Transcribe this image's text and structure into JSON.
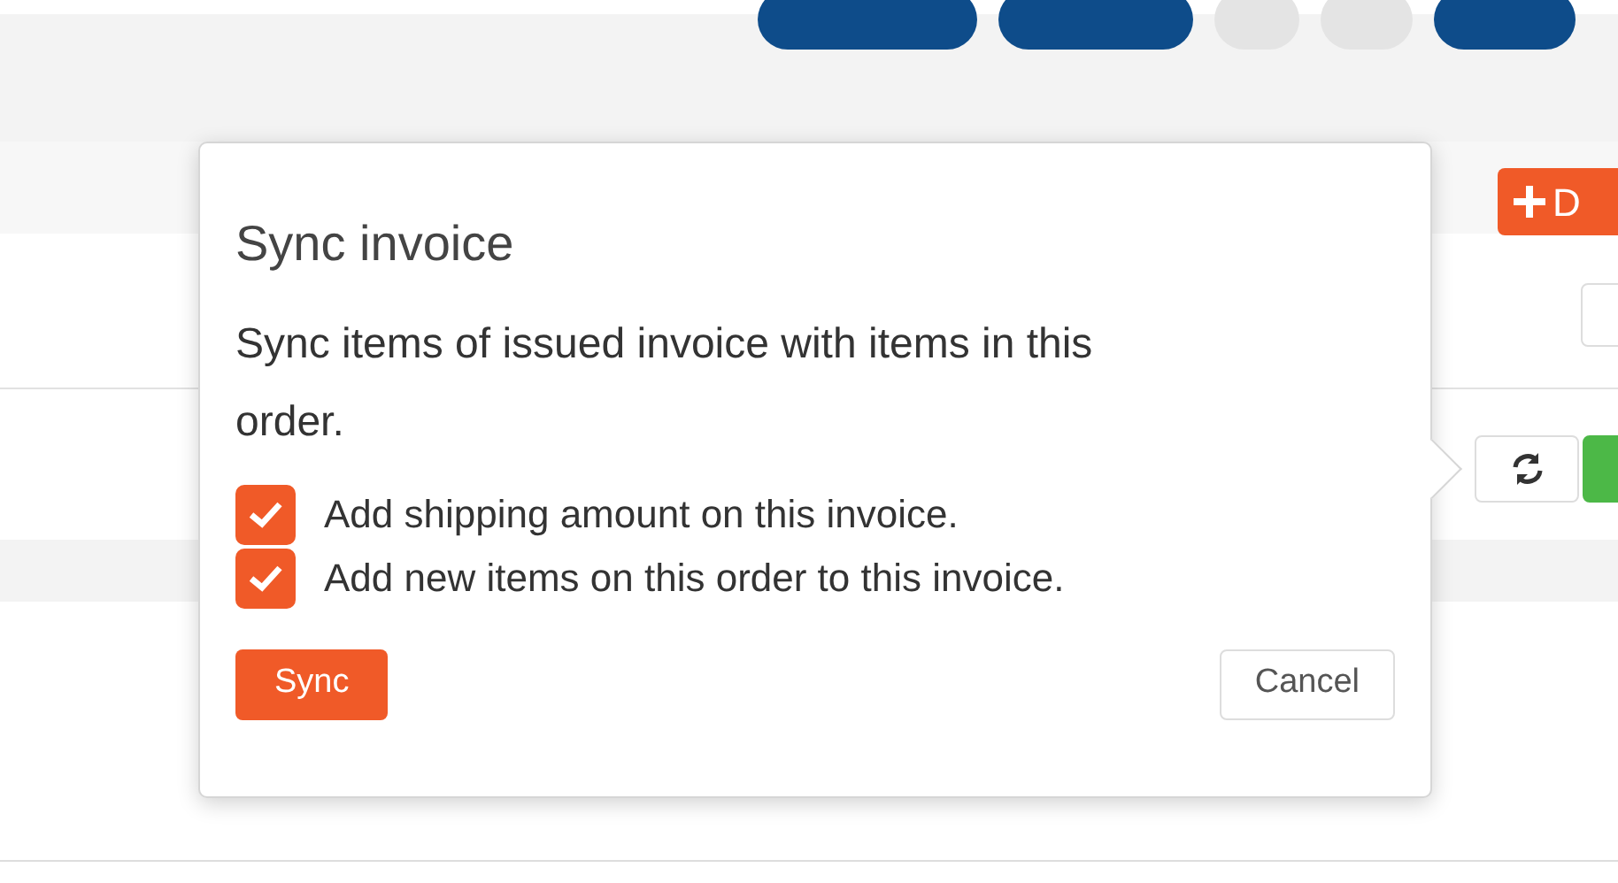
{
  "toolbar_buttons": [
    {
      "kind": "primary"
    },
    {
      "kind": "primary"
    },
    {
      "kind": "plain"
    },
    {
      "kind": "plain"
    },
    {
      "kind": "primary"
    }
  ],
  "add_button": {
    "label": "D"
  },
  "row_buttons": [
    {
      "kind": "refresh"
    },
    {
      "kind": "success"
    }
  ],
  "popover": {
    "title": "Sync invoice",
    "message": "Sync items of issued invoice with items in this order.",
    "options": [
      {
        "label": "Add shipping amount on this invoice.",
        "checked": true
      },
      {
        "label": "Add new items on this order to this invoice.",
        "checked": true
      }
    ],
    "confirm": "Sync",
    "cancel": "Cancel"
  }
}
